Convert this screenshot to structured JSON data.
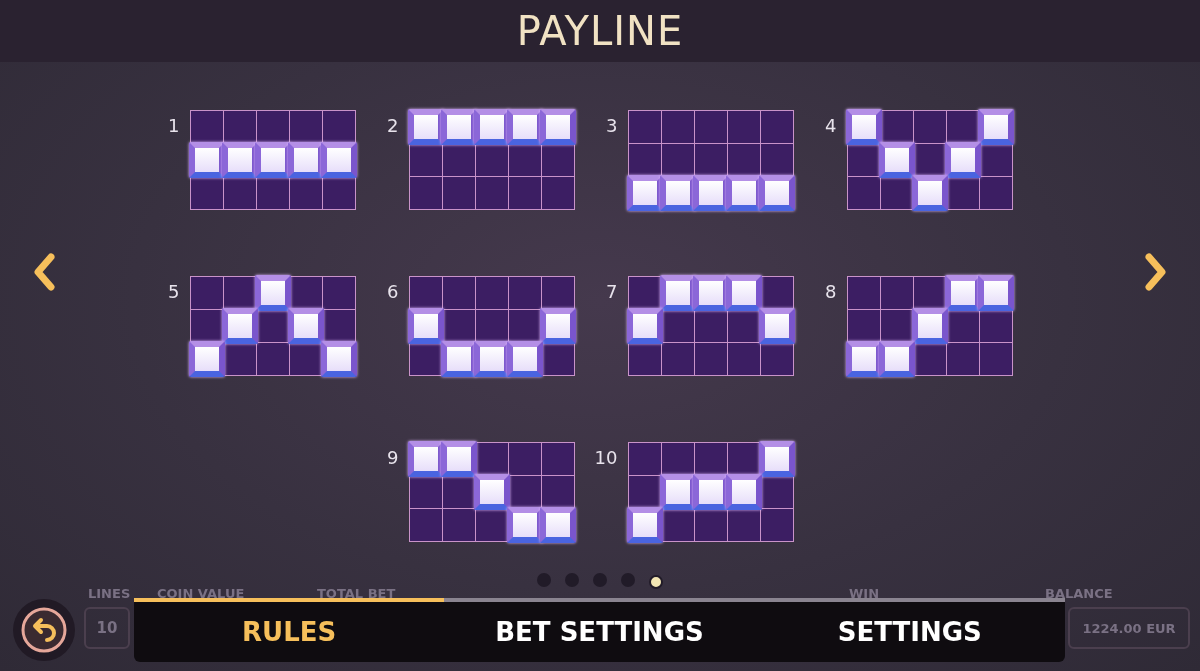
{
  "title": "PAYLINE",
  "paylines": [
    {
      "number": "1",
      "lit": [
        [
          false,
          false,
          false,
          false,
          false
        ],
        [
          true,
          true,
          true,
          true,
          true
        ],
        [
          false,
          false,
          false,
          false,
          false
        ]
      ]
    },
    {
      "number": "2",
      "lit": [
        [
          true,
          true,
          true,
          true,
          true
        ],
        [
          false,
          false,
          false,
          false,
          false
        ],
        [
          false,
          false,
          false,
          false,
          false
        ]
      ]
    },
    {
      "number": "3",
      "lit": [
        [
          false,
          false,
          false,
          false,
          false
        ],
        [
          false,
          false,
          false,
          false,
          false
        ],
        [
          true,
          true,
          true,
          true,
          true
        ]
      ]
    },
    {
      "number": "4",
      "lit": [
        [
          true,
          false,
          false,
          false,
          true
        ],
        [
          false,
          true,
          false,
          true,
          false
        ],
        [
          false,
          false,
          true,
          false,
          false
        ]
      ]
    },
    {
      "number": "5",
      "lit": [
        [
          false,
          false,
          true,
          false,
          false
        ],
        [
          false,
          true,
          false,
          true,
          false
        ],
        [
          true,
          false,
          false,
          false,
          true
        ]
      ]
    },
    {
      "number": "6",
      "lit": [
        [
          false,
          false,
          false,
          false,
          false
        ],
        [
          true,
          false,
          false,
          false,
          true
        ],
        [
          false,
          true,
          true,
          true,
          false
        ]
      ]
    },
    {
      "number": "7",
      "lit": [
        [
          false,
          true,
          true,
          true,
          false
        ],
        [
          true,
          false,
          false,
          false,
          true
        ],
        [
          false,
          false,
          false,
          false,
          false
        ]
      ]
    },
    {
      "number": "8",
      "lit": [
        [
          false,
          false,
          false,
          true,
          true
        ],
        [
          false,
          false,
          true,
          false,
          false
        ],
        [
          true,
          true,
          false,
          false,
          false
        ]
      ]
    },
    {
      "number": "9",
      "lit": [
        [
          true,
          true,
          false,
          false,
          false
        ],
        [
          false,
          false,
          true,
          false,
          false
        ],
        [
          false,
          false,
          false,
          true,
          true
        ]
      ]
    },
    {
      "number": "10",
      "lit": [
        [
          false,
          false,
          false,
          false,
          true
        ],
        [
          false,
          true,
          true,
          true,
          false
        ],
        [
          true,
          false,
          false,
          false,
          false
        ]
      ]
    }
  ],
  "pages": [
    {
      "selected": false
    },
    {
      "selected": false
    },
    {
      "selected": false
    },
    {
      "selected": false
    },
    {
      "selected": true
    }
  ],
  "hud": {
    "labels": [
      "LINES",
      "COIN VALUE",
      "TOTAL BET",
      "WIN",
      "BALANCE"
    ],
    "lines": "10",
    "balance": "1224.00 EUR"
  },
  "tabs": [
    {
      "label": "RULES",
      "selected": true
    },
    {
      "label": "BET SETTINGS",
      "selected": false
    },
    {
      "label": "SETTINGS",
      "selected": false
    }
  ]
}
